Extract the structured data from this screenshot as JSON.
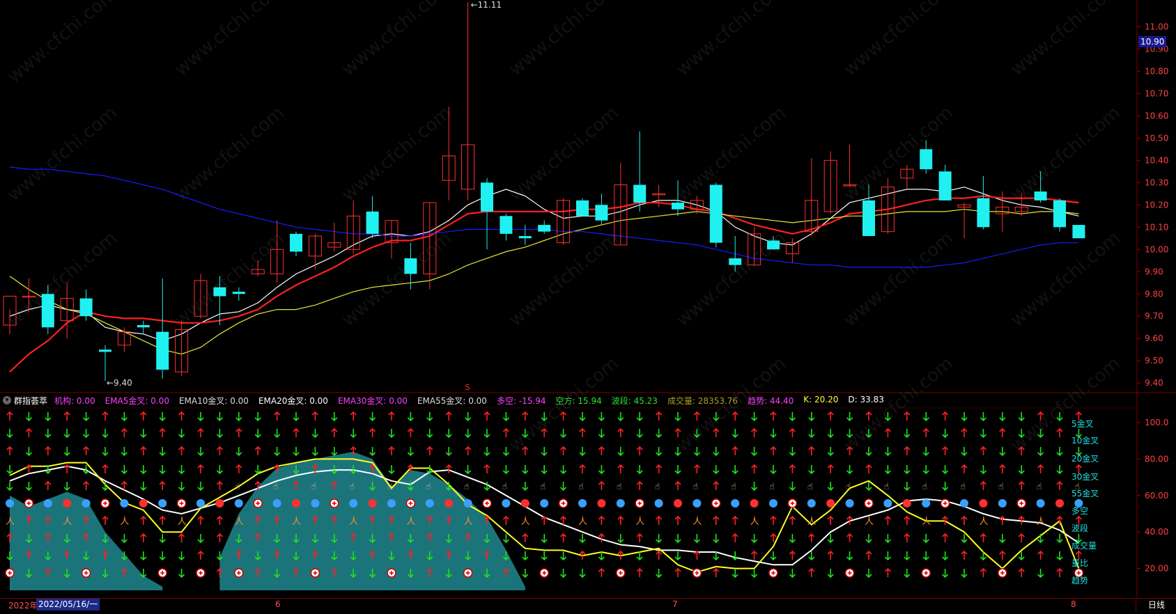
{
  "chart_data": {
    "type": "candlestick",
    "price_axis": {
      "ticks": [
        "11.00",
        "10.90",
        "10.80",
        "10.70",
        "10.60",
        "10.50",
        "10.40",
        "10.30",
        "10.20",
        "10.10",
        "10.00",
        "9.90",
        "9.80",
        "9.70",
        "9.60",
        "9.50",
        "9.40"
      ],
      "ylim": [
        9.36,
        11.12
      ]
    },
    "annotations": {
      "high": "11.11",
      "low": "9.40"
    },
    "candles": [
      {
        "o": 9.66,
        "h": 9.73,
        "l": 9.62,
        "c": 9.79
      },
      {
        "o": 9.79,
        "h": 9.87,
        "l": 9.72,
        "c": 9.79
      },
      {
        "o": 9.8,
        "h": 9.84,
        "l": 9.62,
        "c": 9.65
      },
      {
        "o": 9.68,
        "h": 9.85,
        "l": 9.6,
        "c": 9.78
      },
      {
        "o": 9.78,
        "h": 9.82,
        "l": 9.68,
        "c": 9.7
      },
      {
        "o": 9.55,
        "h": 9.57,
        "l": 9.41,
        "c": 9.54
      },
      {
        "o": 9.57,
        "h": 9.65,
        "l": 9.54,
        "c": 9.63
      },
      {
        "o": 9.66,
        "h": 9.68,
        "l": 9.62,
        "c": 9.65
      },
      {
        "o": 9.63,
        "h": 9.87,
        "l": 9.42,
        "c": 9.46
      },
      {
        "o": 9.45,
        "h": 9.68,
        "l": 9.43,
        "c": 9.64
      },
      {
        "o": 9.7,
        "h": 9.89,
        "l": 9.69,
        "c": 9.86
      },
      {
        "o": 9.83,
        "h": 9.88,
        "l": 9.66,
        "c": 9.79
      },
      {
        "o": 9.81,
        "h": 9.83,
        "l": 9.77,
        "c": 9.8
      },
      {
        "o": 9.89,
        "h": 9.95,
        "l": 9.88,
        "c": 9.91
      },
      {
        "o": 9.89,
        "h": 10.13,
        "l": 9.85,
        "c": 10.0
      },
      {
        "o": 10.07,
        "h": 10.08,
        "l": 9.97,
        "c": 9.99
      },
      {
        "o": 9.97,
        "h": 10.07,
        "l": 9.91,
        "c": 10.06
      },
      {
        "o": 10.01,
        "h": 10.12,
        "l": 9.99,
        "c": 10.03
      },
      {
        "o": 10.0,
        "h": 10.22,
        "l": 9.98,
        "c": 10.15
      },
      {
        "o": 10.17,
        "h": 10.24,
        "l": 10.05,
        "c": 10.07
      },
      {
        "o": 10.03,
        "h": 10.13,
        "l": 9.96,
        "c": 10.13
      },
      {
        "o": 9.96,
        "h": 10.03,
        "l": 9.82,
        "c": 9.89
      },
      {
        "o": 9.89,
        "h": 10.21,
        "l": 9.82,
        "c": 10.21
      },
      {
        "o": 10.31,
        "h": 10.64,
        "l": 10.22,
        "c": 10.42
      },
      {
        "o": 10.27,
        "h": 11.11,
        "l": 10.22,
        "c": 10.47
      },
      {
        "o": 10.3,
        "h": 10.32,
        "l": 10.0,
        "c": 10.17
      },
      {
        "o": 10.15,
        "h": 10.16,
        "l": 10.04,
        "c": 10.07
      },
      {
        "o": 10.06,
        "h": 10.11,
        "l": 10.02,
        "c": 10.05
      },
      {
        "o": 10.11,
        "h": 10.13,
        "l": 10.07,
        "c": 10.08
      },
      {
        "o": 10.03,
        "h": 10.23,
        "l": 10.02,
        "c": 10.22
      },
      {
        "o": 10.22,
        "h": 10.23,
        "l": 10.15,
        "c": 10.15
      },
      {
        "o": 10.2,
        "h": 10.25,
        "l": 10.11,
        "c": 10.13
      },
      {
        "o": 10.02,
        "h": 10.39,
        "l": 10.02,
        "c": 10.29
      },
      {
        "o": 10.29,
        "h": 10.53,
        "l": 10.17,
        "c": 10.21
      },
      {
        "o": 10.25,
        "h": 10.29,
        "l": 10.19,
        "c": 10.25
      },
      {
        "o": 10.21,
        "h": 10.31,
        "l": 10.15,
        "c": 10.18
      },
      {
        "o": 10.18,
        "h": 10.24,
        "l": 10.16,
        "c": 10.22
      },
      {
        "o": 10.29,
        "h": 10.3,
        "l": 10.01,
        "c": 10.03
      },
      {
        "o": 9.96,
        "h": 10.06,
        "l": 9.9,
        "c": 9.93
      },
      {
        "o": 9.93,
        "h": 10.1,
        "l": 9.93,
        "c": 10.07
      },
      {
        "o": 10.04,
        "h": 10.06,
        "l": 10.0,
        "c": 10.0
      },
      {
        "o": 9.98,
        "h": 10.05,
        "l": 9.94,
        "c": 10.03
      },
      {
        "o": 10.08,
        "h": 10.41,
        "l": 10.06,
        "c": 10.22
      },
      {
        "o": 10.17,
        "h": 10.44,
        "l": 10.16,
        "c": 10.4
      },
      {
        "o": 10.29,
        "h": 10.47,
        "l": 10.28,
        "c": 10.29
      },
      {
        "o": 10.22,
        "h": 10.29,
        "l": 10.07,
        "c": 10.06
      },
      {
        "o": 10.08,
        "h": 10.32,
        "l": 10.07,
        "c": 10.28
      },
      {
        "o": 10.32,
        "h": 10.38,
        "l": 10.27,
        "c": 10.36
      },
      {
        "o": 10.45,
        "h": 10.49,
        "l": 10.34,
        "c": 10.36
      },
      {
        "o": 10.35,
        "h": 10.38,
        "l": 10.22,
        "c": 10.22
      },
      {
        "o": 10.19,
        "h": 10.21,
        "l": 10.05,
        "c": 10.2
      },
      {
        "o": 10.23,
        "h": 10.33,
        "l": 10.09,
        "c": 10.1
      },
      {
        "o": 10.16,
        "h": 10.26,
        "l": 10.08,
        "c": 10.19
      },
      {
        "o": 10.17,
        "h": 10.25,
        "l": 10.15,
        "c": 10.19
      },
      {
        "o": 10.26,
        "h": 10.35,
        "l": 10.21,
        "c": 10.22
      },
      {
        "o": 10.22,
        "h": 10.23,
        "l": 10.08,
        "c": 10.1
      },
      {
        "o": 10.11,
        "h": 10.11,
        "l": 10.05,
        "c": 10.05
      }
    ],
    "series": [
      {
        "color": "#ffffff",
        "values": [
          9.7,
          9.73,
          9.75,
          9.73,
          9.72,
          9.65,
          9.63,
          9.62,
          9.59,
          9.62,
          9.67,
          9.71,
          9.72,
          9.76,
          9.83,
          9.89,
          9.93,
          9.97,
          10.02,
          10.06,
          10.07,
          10.06,
          10.08,
          10.13,
          10.2,
          10.24,
          10.27,
          10.24,
          10.18,
          10.14,
          10.15,
          10.15,
          10.17,
          10.2,
          10.22,
          10.22,
          10.2,
          10.17,
          10.1,
          10.06,
          10.03,
          10.02,
          10.07,
          10.14,
          10.21,
          10.23,
          10.25,
          10.27,
          10.27,
          10.26,
          10.28,
          10.25,
          10.22,
          10.2,
          10.19,
          10.17,
          10.15
        ]
      },
      {
        "color": "#ff2020",
        "values": [
          9.45,
          9.53,
          9.59,
          9.67,
          9.72,
          9.7,
          9.69,
          9.69,
          9.68,
          9.67,
          9.67,
          9.68,
          9.7,
          9.73,
          9.79,
          9.84,
          9.88,
          9.92,
          9.97,
          10.01,
          10.04,
          10.04,
          10.06,
          10.11,
          10.16,
          10.17,
          10.17,
          10.17,
          10.17,
          10.17,
          10.18,
          10.18,
          10.19,
          10.21,
          10.21,
          10.2,
          10.18,
          10.17,
          10.14,
          10.11,
          10.09,
          10.07,
          10.09,
          10.12,
          10.16,
          10.17,
          10.18,
          10.2,
          10.22,
          10.23,
          10.23,
          10.24,
          10.23,
          10.23,
          10.23,
          10.22,
          10.21
        ]
      },
      {
        "color": "#e8e830",
        "values": [
          9.88,
          9.82,
          9.77,
          9.73,
          9.71,
          9.67,
          9.63,
          9.59,
          9.55,
          9.53,
          9.56,
          9.62,
          9.67,
          9.71,
          9.73,
          9.73,
          9.75,
          9.78,
          9.81,
          9.83,
          9.84,
          9.85,
          9.86,
          9.89,
          9.93,
          9.96,
          9.99,
          10.01,
          10.04,
          10.07,
          10.09,
          10.11,
          10.13,
          10.14,
          10.15,
          10.16,
          10.17,
          10.16,
          10.15,
          10.14,
          10.13,
          10.12,
          10.13,
          10.14,
          10.15,
          10.15,
          10.16,
          10.17,
          10.17,
          10.17,
          10.18,
          10.17,
          10.17,
          10.16,
          10.17,
          10.17,
          10.16
        ]
      },
      {
        "color": "#1a1aff",
        "values": [
          10.37,
          10.36,
          10.36,
          10.35,
          10.34,
          10.33,
          10.31,
          10.29,
          10.27,
          10.24,
          10.21,
          10.18,
          10.16,
          10.14,
          10.12,
          10.1,
          10.09,
          10.08,
          10.07,
          10.07,
          10.06,
          10.06,
          10.07,
          10.08,
          10.09,
          10.09,
          10.09,
          10.09,
          10.09,
          10.08,
          10.08,
          10.07,
          10.06,
          10.05,
          10.04,
          10.03,
          10.02,
          10.0,
          9.98,
          9.96,
          9.95,
          9.94,
          9.93,
          9.93,
          9.92,
          9.92,
          9.92,
          9.92,
          9.92,
          9.93,
          9.94,
          9.96,
          9.98,
          10.0,
          10.02,
          10.03,
          10.03
        ]
      }
    ],
    "indicator": {
      "ticks": [
        "100.0",
        "80.00",
        "60.00",
        "40.00",
        "20.00"
      ],
      "ylim": [
        8,
        108
      ],
      "white": [
        68,
        72,
        74,
        76,
        74,
        68,
        63,
        58,
        52,
        50,
        53,
        56,
        60,
        64,
        68,
        71,
        73,
        74,
        74,
        72,
        68,
        66,
        73,
        74,
        70,
        66,
        60,
        54,
        48,
        44,
        40,
        36,
        33,
        32,
        30,
        30,
        29,
        29,
        26,
        24,
        22,
        22,
        30,
        40,
        46,
        49,
        52,
        57,
        58,
        57,
        54,
        50,
        47,
        46,
        45,
        41,
        34
      ],
      "yellow": [
        71,
        76,
        76,
        78,
        78,
        66,
        56,
        52,
        40,
        40,
        53,
        59,
        65,
        72,
        76,
        78,
        80,
        80,
        80,
        78,
        64,
        75,
        75,
        66,
        55,
        49,
        40,
        31,
        30,
        30,
        27,
        29,
        27,
        29,
        31,
        22,
        18,
        21,
        20,
        20,
        32,
        54,
        44,
        52,
        64,
        68,
        60,
        51,
        46,
        46,
        40,
        29,
        20,
        30,
        38,
        46,
        20
      ],
      "teal": [
        60,
        54,
        58,
        62,
        58,
        40,
        28,
        16,
        10,
        10,
        10,
        26,
        50,
        65,
        75,
        78,
        80,
        82,
        84,
        80,
        65,
        74,
        72,
        66,
        58,
        48,
        30,
        10
      ]
    },
    "legend_right": [
      "5金叉",
      "10金叉",
      "20金叉",
      "30金叉",
      "55金叉",
      "多空",
      "波段",
      "成交量",
      "量比",
      "趋势"
    ],
    "status": {
      "indicator_name": "群指荟萃",
      "items": [
        {
          "label": "机构: 0.00",
          "color": "#ff40ff"
        },
        {
          "label": "EMA5金叉: 0.00",
          "color": "#ff40ff"
        },
        {
          "label": "EMA10金叉: 0.00",
          "color": "#dddddd"
        },
        {
          "label": "EMA20金叉: 0.00",
          "color": "#ffffff"
        },
        {
          "label": "EMA30金叉: 0.00",
          "color": "#ff40ff"
        },
        {
          "label": "EMA55金叉: 0.00",
          "color": "#dddddd"
        },
        {
          "label": "多空: -15.94",
          "color": "#ff40ff"
        },
        {
          "label": "空方: 15.94",
          "color": "#30e030"
        },
        {
          "label": "波段: 45.23",
          "color": "#30e030"
        },
        {
          "label": "成交量: 28353.76",
          "color": "#b0a020"
        },
        {
          "label": "趋势: 44.40",
          "color": "#ff40ff"
        },
        {
          "label": "K: 20.20",
          "color": "#ffff40"
        },
        {
          "label": "D: 33.83",
          "color": "#ffffff"
        }
      ]
    },
    "timeline": {
      "year": "2022年",
      "date": "2022/05/16/一",
      "months": [
        "6",
        "7",
        "8"
      ],
      "period": "日线"
    },
    "current_price": "10.90",
    "marker_s": "S",
    "watermark": "www.cfchi.com"
  }
}
